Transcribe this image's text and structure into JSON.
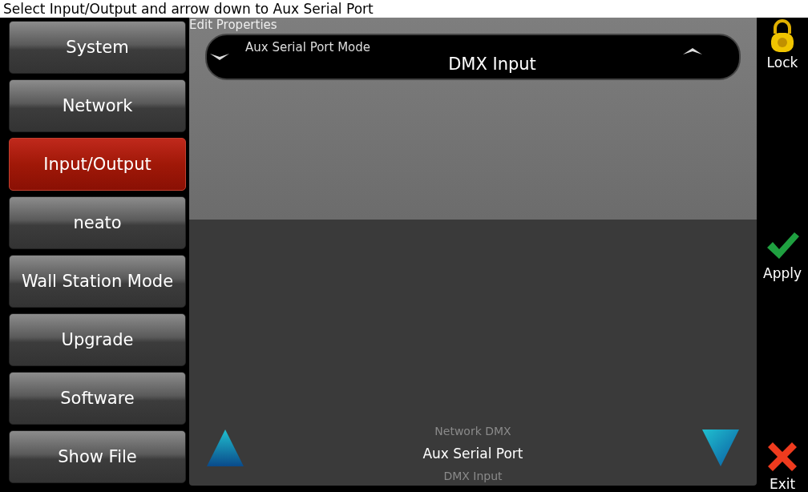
{
  "caption": "Select Input/Output and arrow down to Aux Serial Port",
  "sidebar": {
    "items": [
      {
        "label": "System",
        "selected": false
      },
      {
        "label": "Network",
        "selected": false
      },
      {
        "label": "Input/Output",
        "selected": true
      },
      {
        "label": "neato",
        "selected": false
      },
      {
        "label": "Wall Station Mode",
        "selected": false
      },
      {
        "label": "Upgrade",
        "selected": false
      },
      {
        "label": "Software",
        "selected": false
      },
      {
        "label": "Show File",
        "selected": false
      }
    ]
  },
  "panel": {
    "title": "Edit Properties",
    "field": {
      "label": "Aux Serial Port Mode",
      "value": "DMX Input"
    },
    "picker": {
      "previous": "Network DMX",
      "current": "Aux Serial Port",
      "next": "DMX Input"
    }
  },
  "actions": [
    {
      "kind": "lock",
      "label": "Lock"
    },
    {
      "kind": "apply",
      "label": "Apply"
    },
    {
      "kind": "exit",
      "label": "Exit"
    }
  ]
}
